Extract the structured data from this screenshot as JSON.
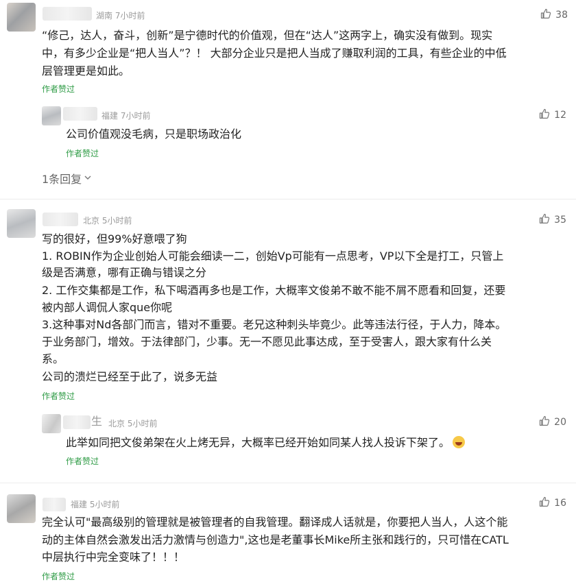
{
  "comments": [
    {
      "location": "湖南",
      "time": "7小时前",
      "likes": "38",
      "lines": [
        "“修己，达人，奋斗，创新”是宁德时代的价值观，但在“达人”这两字上，确实没有做到。现实",
        "中，有多少企业是“把人当人”？！ 大部分企业只是把人当成了赚取利润的工具，有些企业的中低",
        "层管理更是如此。"
      ],
      "author_tag": "作者赞过",
      "reply": {
        "location": "福建",
        "time": "7小时前",
        "likes": "12",
        "lines": [
          "公司价值观没毛病，只是职场政治化"
        ],
        "author_tag": "作者赞过"
      },
      "reply_toggle": "1条回复"
    },
    {
      "location": "北京",
      "time": "5小时前",
      "likes": "35",
      "lines": [
        "写的很好，但99%好意喂了狗",
        "1. ROBIN作为企业创始人可能会细读一二，创始Vp可能有一点思考，VP以下全是打工，只管上",
        "级是否满意，哪有正确与错误之分",
        "2. 工作交集都是工作，私下喝酒再多也是工作，大概率文俊弟不敢不能不屑不愿看和回复，还要",
        "被内部人调侃人家que你呢",
        "3.这种事对Nd各部门而言，错对不重要。老兄这种刺头毕竟少。此等违法行径，于人力，降本。",
        "于业务部门，增效。于法律部门，少事。无一不愿见此事达成，至于受害人，跟大家有什么关",
        "系。",
        "公司的溃烂已经至于此了，说多无益"
      ],
      "author_tag": "作者赞过",
      "reply": {
        "name_fragment": "生",
        "location": "北京",
        "time": "5小时前",
        "likes": "20",
        "lines": [
          "此举如同把文俊弟架在火上烤无异，大概率已经开始如同某人找人投诉下架了。"
        ],
        "author_tag": "作者赞过"
      }
    },
    {
      "location": "福建",
      "time": "5小时前",
      "likes": "16",
      "lines": [
        "完全认可\"最高级别的管理就是被管理者的自我管理。翻译成人话就是，你要把人当人，人这个能",
        "动的主体自然会激发出活力激情与创造力\",这也是老董事长Mike所主张和践行的，只可惜在CATL",
        "中层执行中完全变味了！！！"
      ],
      "author_tag": "作者赞过"
    }
  ],
  "colors": {
    "author_tag": "#2e9b45",
    "meta": "#9a9a9a",
    "text": "#222222"
  },
  "icons": {
    "like": "thumbs-up-icon",
    "expand": "chevron-down-icon",
    "emoji": "laughing-emoji-icon"
  }
}
